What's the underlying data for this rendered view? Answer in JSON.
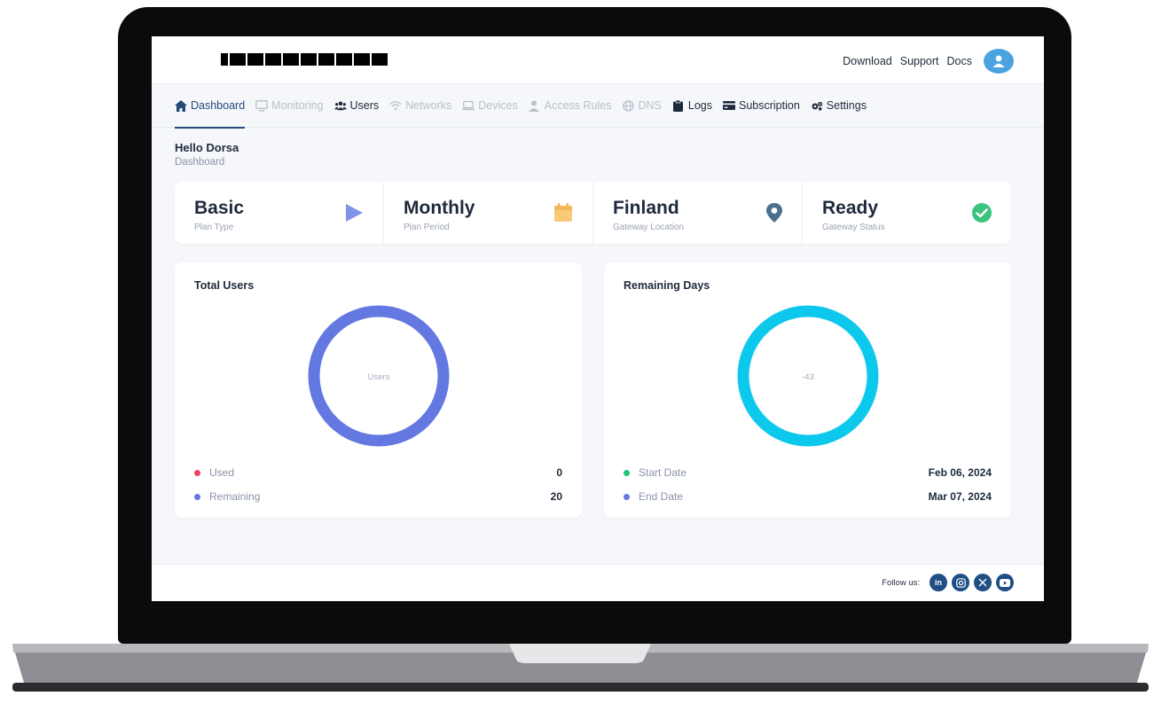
{
  "header": {
    "links": [
      "Download",
      "Support",
      "Docs"
    ]
  },
  "nav": {
    "items": [
      {
        "label": "Dashboard",
        "state": "active",
        "icon": "home-icon"
      },
      {
        "label": "Monitoring",
        "state": "disabled",
        "icon": "monitor-icon"
      },
      {
        "label": "Users",
        "state": "normal",
        "icon": "users-icon"
      },
      {
        "label": "Networks",
        "state": "disabled",
        "icon": "wifi-icon"
      },
      {
        "label": "Devices",
        "state": "disabled",
        "icon": "laptop-icon"
      },
      {
        "label": "Access Rules",
        "state": "disabled",
        "icon": "user-shield-icon"
      },
      {
        "label": "DNS",
        "state": "disabled",
        "icon": "globe-icon"
      },
      {
        "label": "Logs",
        "state": "normal",
        "icon": "clipboard-icon"
      },
      {
        "label": "Subscription",
        "state": "normal",
        "icon": "credit-card-icon"
      },
      {
        "label": "Settings",
        "state": "normal",
        "icon": "gears-icon"
      }
    ]
  },
  "greeting": {
    "hello": "Hello Dorsa",
    "breadcrumb": "Dashboard"
  },
  "stats": [
    {
      "value": "Basic",
      "label": "Plan Type",
      "icon": "play-icon",
      "color": "#7f93e8"
    },
    {
      "value": "Monthly",
      "label": "Plan Period",
      "icon": "calendar-icon",
      "color": "#f9c97a"
    },
    {
      "value": "Finland",
      "label": "Gateway Location",
      "icon": "map-pin-icon",
      "color": "#4a6f8f"
    },
    {
      "value": "Ready",
      "label": "Gateway Status",
      "icon": "check-circle-icon",
      "color": "#3ac47d"
    }
  ],
  "total_users": {
    "title": "Total Users",
    "center_label": "Users",
    "ring_color": "#6378e0",
    "rows": [
      {
        "label": "Used",
        "value": "0",
        "dot_color": "#f0435d"
      },
      {
        "label": "Remaining",
        "value": "20",
        "dot_color": "#6378e0"
      }
    ]
  },
  "remaining_days": {
    "title": "Remaining Days",
    "center_label": "-43",
    "ring_color": "#0cc8ec",
    "rows": [
      {
        "label": "Start Date",
        "value": "Feb 06, 2024",
        "dot_color": "#21c27a"
      },
      {
        "label": "End Date",
        "value": "Mar 07, 2024",
        "dot_color": "#6378e0"
      }
    ]
  },
  "footer": {
    "follow_label": "Follow us:",
    "socials": [
      "linkedin-icon",
      "instagram-icon",
      "x-twitter-icon",
      "youtube-icon"
    ]
  }
}
